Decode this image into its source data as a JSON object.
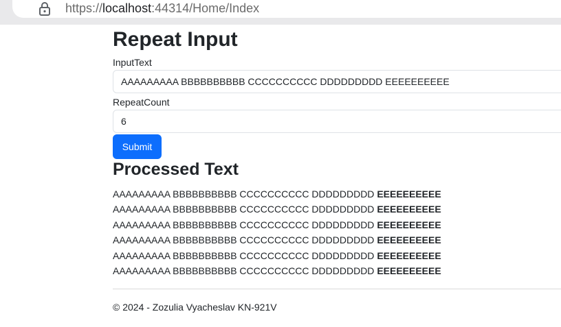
{
  "browser": {
    "url_scheme": "https://",
    "url_host": "localhost",
    "url_rest": ":44314/Home/Index"
  },
  "page": {
    "title": "Repeat Input",
    "input_text_label": "InputText",
    "input_text_value": "AAAAAAAAA BBBBBBBBBB CCCCCCCCCC DDDDDDDDD EEEEEEEEEE",
    "repeat_count_label": "RepeatCount",
    "repeat_count_value": "6",
    "submit_label": "Submit",
    "processed_title": "Processed Text",
    "processed_lines": [
      {
        "normal": "AAAAAAAAA BBBBBBBBBB CCCCCCCCCC DDDDDDDDD ",
        "bold": "EEEEEEEEEE"
      },
      {
        "normal": "AAAAAAAAA BBBBBBBBBB CCCCCCCCCC DDDDDDDDD ",
        "bold": "EEEEEEEEEE"
      },
      {
        "normal": "AAAAAAAAA BBBBBBBBBB CCCCCCCCCC DDDDDDDDD ",
        "bold": "EEEEEEEEEE"
      },
      {
        "normal": "AAAAAAAAA BBBBBBBBBB CCCCCCCCCC DDDDDDDDD ",
        "bold": "EEEEEEEEEE"
      },
      {
        "normal": "AAAAAAAAA BBBBBBBBBB CCCCCCCCCC DDDDDDDDD ",
        "bold": "EEEEEEEEEE"
      },
      {
        "normal": "AAAAAAAAA BBBBBBBBBB CCCCCCCCCC DDDDDDDDD ",
        "bold": "EEEEEEEEEE"
      }
    ],
    "footer": "© 2024 - Zozulia Vyacheslav KN-921V"
  },
  "colors": {
    "primary_button": "#0d6efd",
    "input_border": "#dee2e6"
  },
  "icons": {
    "address_bar": "lock-icon"
  }
}
